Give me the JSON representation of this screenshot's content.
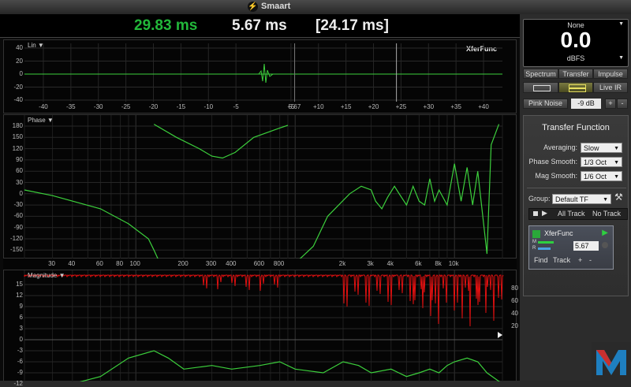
{
  "app": {
    "title": "Smaart",
    "icon": "lightning-bolt-icon"
  },
  "delays": {
    "primary": "29.83 ms",
    "secondary": "5.67 ms",
    "tertiary": "[24.17 ms]",
    "primary_color": "#22b83a"
  },
  "impulse": {
    "label": "Lin ▼",
    "name": "XferFunc",
    "y_ticks": [
      "40",
      "20",
      "0",
      "-20",
      "-40"
    ],
    "x_ticks": [
      "-40",
      "-35",
      "-30",
      "-25",
      "-20",
      "-15",
      "-10",
      "-5",
      "5.67",
      "+5",
      "+10",
      "+15",
      "+20",
      "+25",
      "+30",
      "+35",
      "+40"
    ]
  },
  "phase": {
    "label": "Phase ▼",
    "y_ticks": [
      "180",
      "150",
      "120",
      "90",
      "60",
      "30",
      "0",
      "-30",
      "-60",
      "-90",
      "-120",
      "-150"
    ],
    "freq_ticks": [
      "30",
      "40",
      "60",
      "80",
      "100",
      "200",
      "300",
      "400",
      "600",
      "800",
      "2k",
      "3k",
      "4k",
      "6k",
      "8k",
      "10k"
    ]
  },
  "magnitude": {
    "label": "Magnitude ▼",
    "y_ticks": [
      "15",
      "12",
      "9",
      "6",
      "3",
      "0",
      "-3",
      "-6",
      "-9",
      "-12"
    ],
    "coh_ticks": [
      "80",
      "60",
      "40",
      "20"
    ]
  },
  "meter": {
    "source": "None",
    "value": "0.0",
    "unit": "dBFS"
  },
  "tabs": [
    "Spectrum",
    "Transfer",
    "Impulse"
  ],
  "view": {
    "live_ir": "Live IR"
  },
  "generator": {
    "label": "Pink Noise",
    "level": "-9 dB",
    "plus": "+",
    "minus": "-"
  },
  "transfer": {
    "title": "Transfer Function",
    "averaging_label": "Averaging:",
    "averaging_value": "Slow",
    "phase_smooth_label": "Phase Smooth:",
    "phase_smooth_value": "1/3 Oct",
    "mag_smooth_label": "Mag Smooth:",
    "mag_smooth_value": "1/6 Oct",
    "group_label": "Group:",
    "group_value": "Default TF",
    "all_track": "All Track",
    "no_track": "No Track"
  },
  "measurement": {
    "name": "XferFunc",
    "delay": "5.67",
    "find": "Find",
    "track": "Track",
    "plus": "+",
    "minus": "-",
    "m_label": "M",
    "r_label": "R"
  },
  "colors": {
    "trace": "#3ccf3c",
    "coherence": "#e01010",
    "panel_bg": "#050505",
    "accent_green": "#22b83a"
  }
}
